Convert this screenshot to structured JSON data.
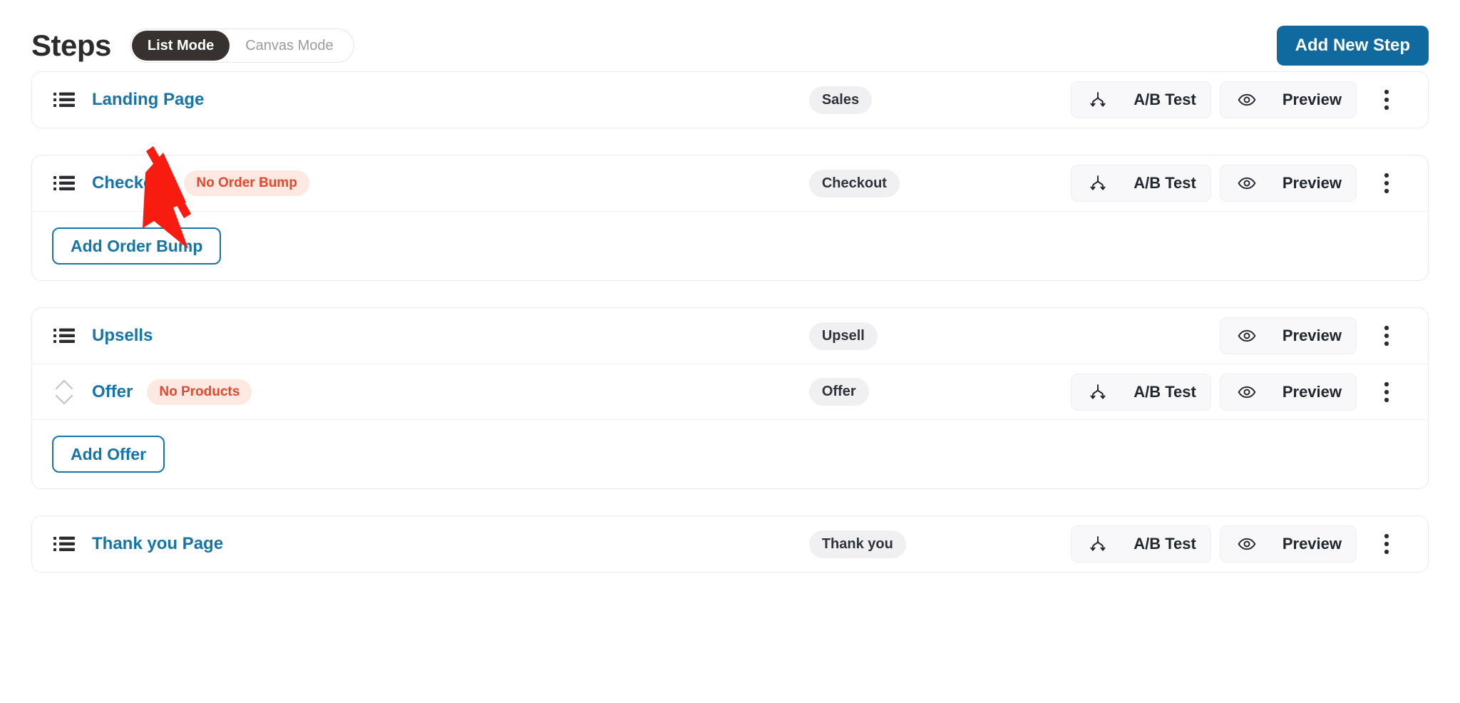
{
  "header": {
    "title": "Steps",
    "mode_toggle": {
      "options": [
        "List Mode",
        "Canvas Mode"
      ],
      "selected": "List Mode"
    },
    "add_new_step_label": "Add New Step"
  },
  "colors": {
    "primary_button": "#10699f",
    "link_blue": "#1575a8",
    "toggle_active_bg": "#37322f",
    "warning_badge_bg": "#fde8e2",
    "warning_badge_text": "#e4492c",
    "type_badge_bg": "#f0f0f3",
    "annotation_arrow": "#f81b0f",
    "card_border": "#eceaf1"
  },
  "action_labels": {
    "ab_test": "A/B Test",
    "preview": "Preview",
    "ab_test_icon": "split-arrow-icon",
    "preview_icon": "eye-icon",
    "kebab_icon": "vertical-dots-icon",
    "list_icon": "bulleted-list-icon",
    "reorder_icon": "up-down-chevron-icon"
  },
  "cards": [
    {
      "rows": [
        {
          "icon": "bulleted-list-icon",
          "name": "Landing Page",
          "warning": null,
          "type_badge": "Sales",
          "has_ab_test": true,
          "has_preview": true,
          "has_kebab": true
        }
      ],
      "footer_action": null
    },
    {
      "rows": [
        {
          "icon": "bulleted-list-icon",
          "name": "Checkout",
          "warning": "No Order Bump",
          "type_badge": "Checkout",
          "has_ab_test": true,
          "has_preview": true,
          "has_kebab": true
        }
      ],
      "footer_action": "Add Order Bump"
    },
    {
      "rows": [
        {
          "icon": "bulleted-list-icon",
          "name": "Upsells",
          "warning": null,
          "type_badge": "Upsell",
          "has_ab_test": false,
          "has_preview": true,
          "has_kebab": true
        },
        {
          "icon": "up-down-chevron-icon",
          "name": "Offer",
          "warning": "No Products",
          "type_badge": "Offer",
          "has_ab_test": true,
          "has_preview": true,
          "has_kebab": true
        }
      ],
      "footer_action": "Add Offer"
    },
    {
      "rows": [
        {
          "icon": "bulleted-list-icon",
          "name": "Thank you Page",
          "warning": null,
          "type_badge": "Thank you",
          "has_ab_test": true,
          "has_preview": true,
          "has_kebab": true
        }
      ],
      "footer_action": null
    }
  ],
  "annotation": {
    "type": "arrow",
    "points_at": "Landing Page",
    "color": "#f81b0f"
  }
}
